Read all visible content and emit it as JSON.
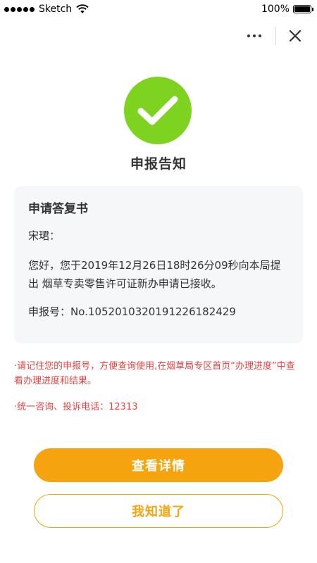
{
  "status_bar": {
    "carrier": "Sketch",
    "battery": "100%"
  },
  "nav": {
    "more_icon": "more-dots-icon",
    "close_icon": "close-icon"
  },
  "result": {
    "icon": "checkmark-icon",
    "title": "申报告知"
  },
  "card": {
    "title": "申请答复书",
    "recipient": "宋珺：",
    "body": "您好，您于2019年12月26日18时26分09秒向本局提出 烟草专卖零售许可证新办申请已接收。",
    "number_label": "申报号：",
    "number_value": "No.1052010320191226182429"
  },
  "tips": [
    "·请记住您的申报号，方便查询使用,在烟草局专区首页“办理进度”中查看办理进度和结果。",
    "·统一咨询、投诉电话：12313"
  ],
  "buttons": {
    "details": "查看详情",
    "acknowledge": "我知道了"
  },
  "colors": {
    "success": "#7ed321",
    "accent": "#f5a30e",
    "tip_text": "#e64340",
    "card_bg": "#f6f7f9"
  }
}
